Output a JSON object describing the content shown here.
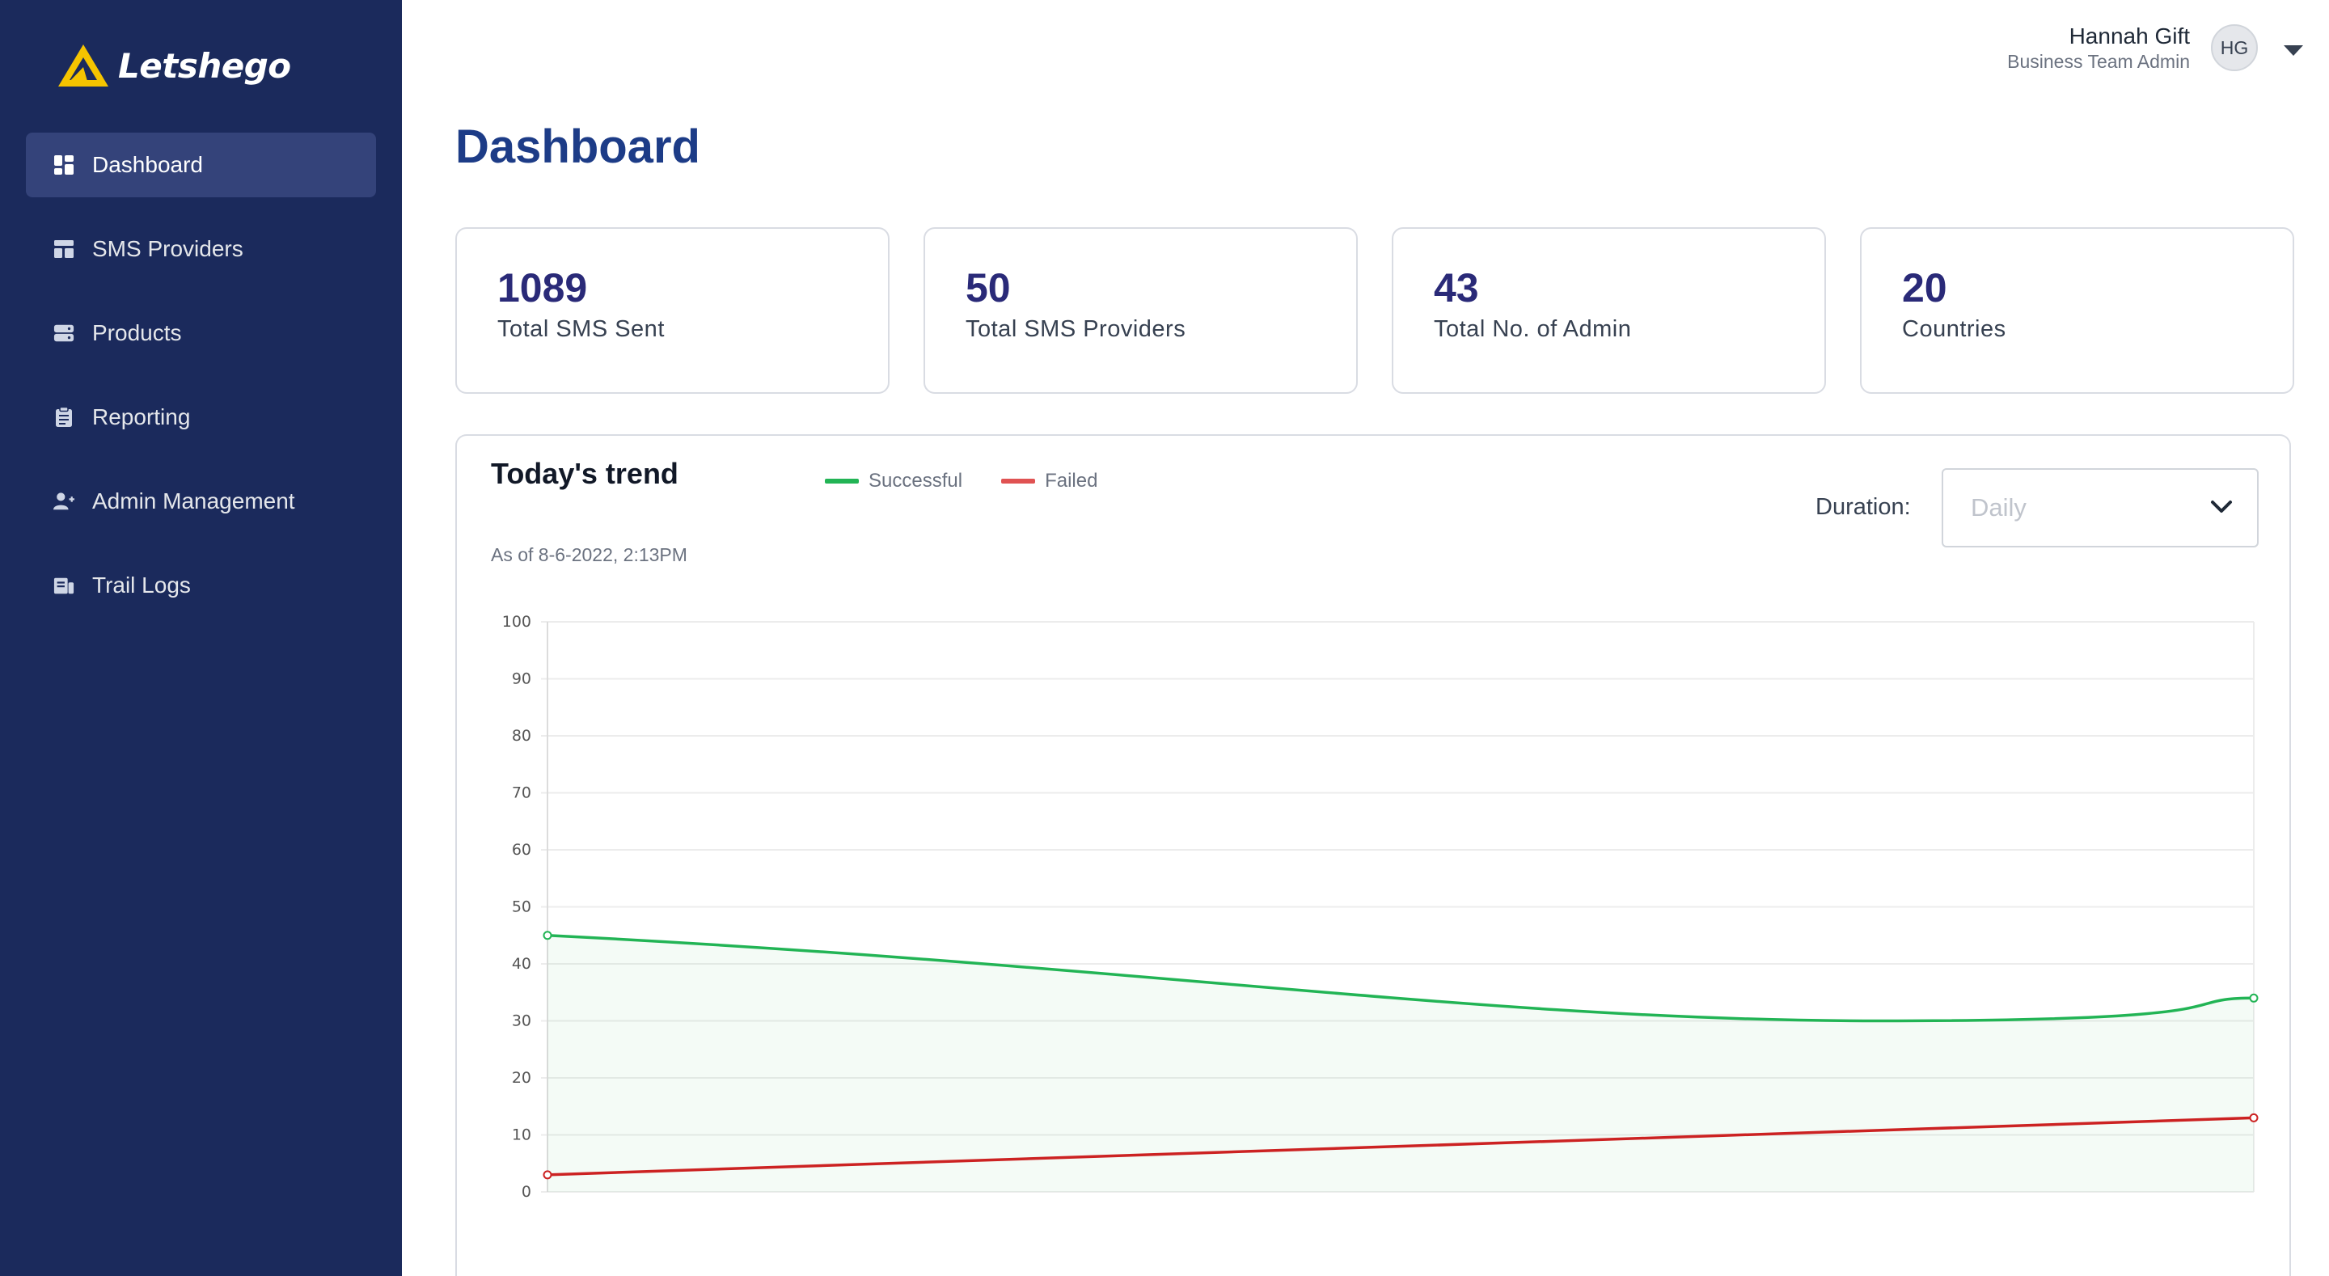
{
  "brand": {
    "name": "Letshego"
  },
  "sidebar": {
    "items": [
      {
        "label": "Dashboard",
        "icon": "dashboard-icon",
        "active": true
      },
      {
        "label": "SMS Providers",
        "icon": "layout-icon",
        "active": false
      },
      {
        "label": "Products",
        "icon": "server-icon",
        "active": false
      },
      {
        "label": "Reporting",
        "icon": "clipboard-icon",
        "active": false
      },
      {
        "label": "Admin Management",
        "icon": "user-plus-icon",
        "active": false
      },
      {
        "label": "Trail Logs",
        "icon": "log-icon",
        "active": false
      }
    ]
  },
  "user": {
    "name": "Hannah Gift",
    "role": "Business Team Admin",
    "initials": "HG"
  },
  "page": {
    "title": "Dashboard"
  },
  "stats": [
    {
      "value": "1089",
      "label": "Total SMS Sent"
    },
    {
      "value": "50",
      "label": "Total SMS Providers"
    },
    {
      "value": "43",
      "label": "Total No. of Admin"
    },
    {
      "value": "20",
      "label": "Countries"
    }
  ],
  "trend": {
    "title": "Today's trend",
    "as_of": "As of 8-6-2022, 2:13PM",
    "duration_label": "Duration:",
    "duration_value": "Daily"
  },
  "colors": {
    "sidebar": "#1b2a5c",
    "accent": "#1d3c87",
    "successful": "#22b455",
    "failed": "#e05252"
  },
  "chart_data": {
    "type": "line",
    "title": "Today's trend",
    "x": [
      0,
      1
    ],
    "ylim": [
      0,
      100
    ],
    "y_ticks": [
      0,
      10,
      20,
      30,
      40,
      50,
      60,
      70,
      80,
      90,
      100
    ],
    "grid": true,
    "legend": "top",
    "series": [
      {
        "name": "Successful",
        "values": [
          45,
          34
        ],
        "color": "#22b455",
        "fill": true
      },
      {
        "name": "Failed",
        "values": [
          3,
          13
        ],
        "color": "#cc2222",
        "fill": false
      }
    ]
  }
}
